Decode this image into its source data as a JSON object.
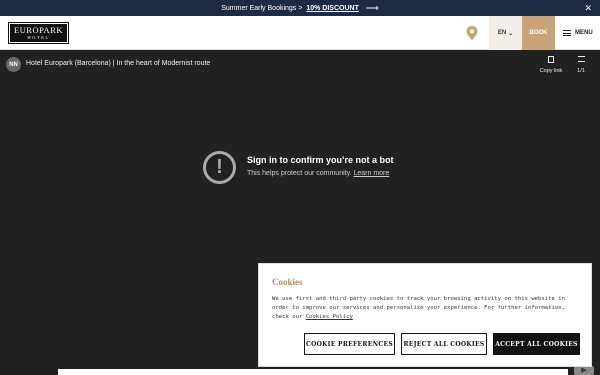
{
  "promo": {
    "text": "Summer Early Bookings >",
    "discount": "10% DISCOUNT",
    "arrow": "⟶",
    "close": "✕"
  },
  "header": {
    "logo_line1": "EUROPARK",
    "logo_line2": "HOTEL",
    "lang": "EN",
    "lang_chevron": "⌄",
    "book": "BOOK",
    "menu": "MENU"
  },
  "video": {
    "channel_initials": "NN",
    "title": "Hotel Europark (Barcelona) | In the heart of Modernist route",
    "copy_link": "Copy link",
    "counter": "1/1",
    "bot_title": "Sign in to confirm you’re not a bot",
    "bot_sub": "This helps protect our community.",
    "learn_more": "Learn more",
    "bot_icon": "!"
  },
  "cookies": {
    "title": "Cookies",
    "body": "We use first and third-party cookies to track your browsing activity on this website in order to improve our services and personalize your experience. For further information, check our",
    "link": "Cookies Policy",
    "pref": "COOKIE PREFERENCES",
    "reject": "REJECT ALL COOKIES",
    "accept": "ACCEPT ALL COOKIES"
  },
  "colors": {
    "promo_bg": "#1d2a44",
    "accent_gold": "#c9a27a",
    "video_bg": "#212121"
  }
}
